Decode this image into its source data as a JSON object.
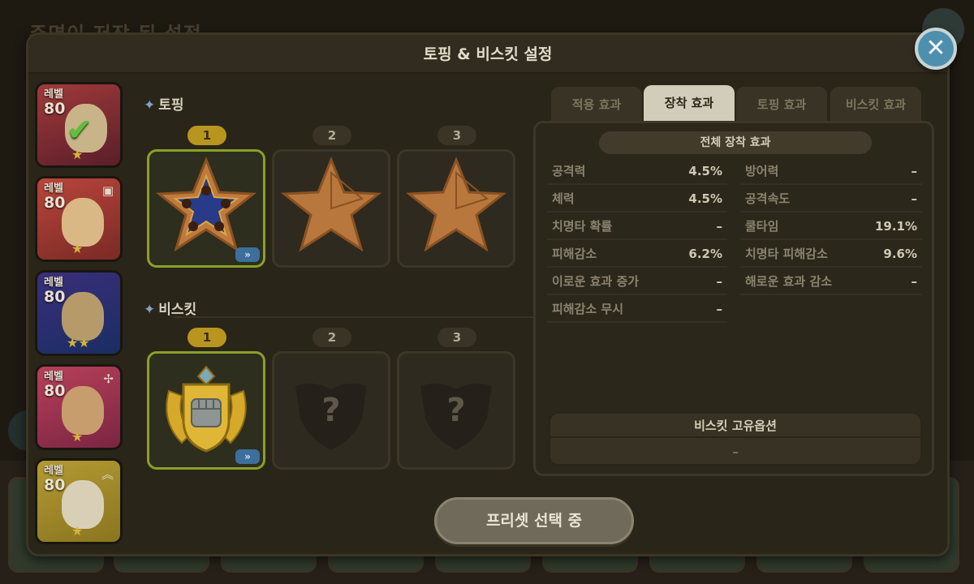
{
  "background": {
    "title": "주명이 저장 된 설정"
  },
  "modal": {
    "title": "토핑 & 비스킷 설정"
  },
  "cookies": [
    {
      "level_label": "레벨",
      "level": "80",
      "selected": true,
      "stars": "★",
      "badge": ""
    },
    {
      "level_label": "레벨",
      "level": "80",
      "selected": false,
      "stars": "★",
      "badge": "▣"
    },
    {
      "level_label": "레벨",
      "level": "80",
      "selected": false,
      "stars": "★★",
      "badge": ""
    },
    {
      "level_label": "레벨",
      "level": "80",
      "selected": false,
      "stars": "★",
      "badge": "✢"
    },
    {
      "level_label": "레벨",
      "level": "80",
      "selected": false,
      "stars": "★",
      "badge": "︽"
    }
  ],
  "topping": {
    "title": "토핑",
    "slots": [
      {
        "num": "1",
        "active": true,
        "icon": "star-topping-icon",
        "swap": "»"
      },
      {
        "num": "2",
        "active": false,
        "icon": "star-topping-icon"
      },
      {
        "num": "3",
        "active": false,
        "icon": "star-topping-icon"
      }
    ]
  },
  "biscuit": {
    "title": "비스킷",
    "slots": [
      {
        "num": "1",
        "active": true,
        "icon": "fist-crest-biscuit-icon",
        "swap": "»"
      },
      {
        "num": "2",
        "active": false,
        "empty": "?"
      },
      {
        "num": "3",
        "active": false,
        "empty": "?"
      }
    ]
  },
  "tabs": [
    {
      "label": "적용 효과",
      "active": false
    },
    {
      "label": "장착 효과",
      "active": true
    },
    {
      "label": "토핑 효과",
      "active": false
    },
    {
      "label": "비스킷 효과",
      "active": false
    }
  ],
  "stats": {
    "header": "전체 장착 효과",
    "left": [
      {
        "k": "공격력",
        "v": "4.5%"
      },
      {
        "k": "체력",
        "v": "4.5%"
      },
      {
        "k": "치명타 확률",
        "v": "–"
      },
      {
        "k": "피해감소",
        "v": "6.2%"
      },
      {
        "k": "이로운 효과 증가",
        "v": "–"
      },
      {
        "k": "피해감소 무시",
        "v": "–"
      }
    ],
    "right": [
      {
        "k": "방어력",
        "v": "–"
      },
      {
        "k": "공격속도",
        "v": "–"
      },
      {
        "k": "쿨타임",
        "v": "19.1%"
      },
      {
        "k": "치명타 피해감소",
        "v": "9.6%"
      },
      {
        "k": "해로운 효과 감소",
        "v": "–"
      }
    ],
    "unique_title": "비스킷 고유옵션",
    "unique_value": "–"
  },
  "preset_button": "프리셋 선택 중",
  "colors": {
    "accent_gold": "#b8951e",
    "active_border": "#8aa02a",
    "close_blue": "#4f8fae"
  }
}
